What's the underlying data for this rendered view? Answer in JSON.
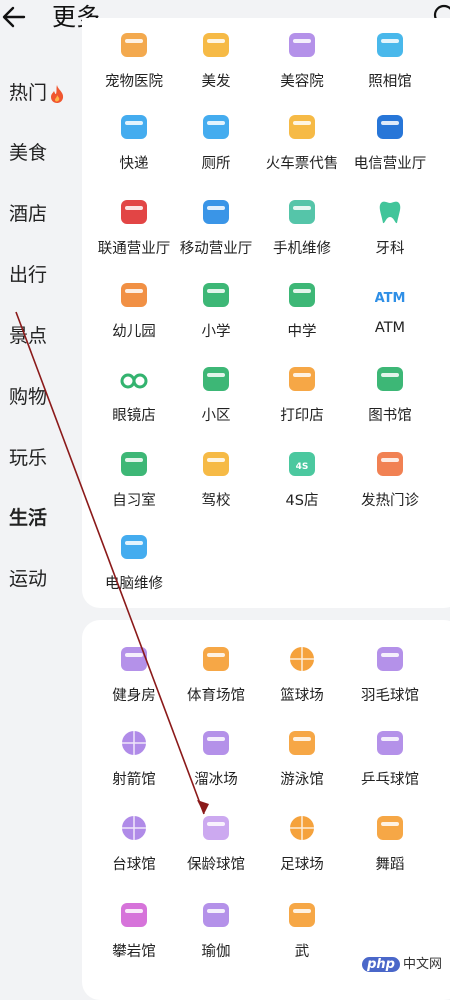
{
  "header": {
    "title": "更多"
  },
  "sidebar": {
    "items": [
      "热门",
      "美食",
      "酒店",
      "出行",
      "景点",
      "购物",
      "玩乐",
      "生活",
      "运动"
    ]
  },
  "section1": {
    "items": [
      {
        "label": "宠物医院",
        "icon": "pet-hospital",
        "color": "#f2a445"
      },
      {
        "label": "美发",
        "icon": "hair-salon",
        "color": "#f5b63c"
      },
      {
        "label": "美容院",
        "icon": "beauty-salon",
        "color": "#b08be8"
      },
      {
        "label": "照相馆",
        "icon": "photo-studio",
        "color": "#3fb4ea"
      },
      {
        "label": "快递",
        "icon": "express",
        "color": "#3aa8ee"
      },
      {
        "label": "厕所",
        "icon": "toilet",
        "color": "#3aa8ee"
      },
      {
        "label": "火车票代售",
        "icon": "train-ticket",
        "color": "#f5b63c"
      },
      {
        "label": "电信营业厅",
        "icon": "telecom",
        "color": "#1b6fd6"
      },
      {
        "label": "联通营业厅",
        "icon": "unicom",
        "color": "#e03b3b"
      },
      {
        "label": "移动营业厅",
        "icon": "mobile",
        "color": "#2f8fe6"
      },
      {
        "label": "手机维修",
        "icon": "phone-repair",
        "color": "#4cc2a4"
      },
      {
        "label": "牙科",
        "icon": "dental",
        "color": "#41c59a"
      },
      {
        "label": "幼儿园",
        "icon": "kindergarten",
        "color": "#f08a3a"
      },
      {
        "label": "小学",
        "icon": "primary-school",
        "color": "#33b36f"
      },
      {
        "label": "中学",
        "icon": "middle-school",
        "color": "#33b36f"
      },
      {
        "label": "ATM",
        "icon": "atm",
        "color": "#2f8fe6"
      },
      {
        "label": "眼镜店",
        "icon": "glasses",
        "color": "#33b36f"
      },
      {
        "label": "小区",
        "icon": "community",
        "color": "#33b36f"
      },
      {
        "label": "打印店",
        "icon": "print-shop",
        "color": "#f5a23c"
      },
      {
        "label": "图书馆",
        "icon": "library",
        "color": "#33b36f"
      },
      {
        "label": "自习室",
        "icon": "study-room",
        "color": "#33b36f"
      },
      {
        "label": "驾校",
        "icon": "driving-school",
        "color": "#f5b63c"
      },
      {
        "label": "4S店",
        "icon": "car-dealer",
        "color": "#41c59a"
      },
      {
        "label": "发热门诊",
        "icon": "fever-clinic",
        "color": "#f07a4a"
      },
      {
        "label": "电脑维修",
        "icon": "computer-repair",
        "color": "#3aa8ee"
      }
    ]
  },
  "section2": {
    "items": [
      {
        "label": "健身房",
        "icon": "gym",
        "color": "#b08be8"
      },
      {
        "label": "体育场馆",
        "icon": "stadium",
        "color": "#f5a23c"
      },
      {
        "label": "篮球场",
        "icon": "basketball",
        "color": "#f5a23c"
      },
      {
        "label": "羽毛球馆",
        "icon": "badminton",
        "color": "#b08be8"
      },
      {
        "label": "射箭馆",
        "icon": "archery",
        "color": "#b08be8"
      },
      {
        "label": "溜冰场",
        "icon": "skating",
        "color": "#b08be8"
      },
      {
        "label": "游泳馆",
        "icon": "swimming",
        "color": "#f5a23c"
      },
      {
        "label": "乒乓球馆",
        "icon": "table-tennis",
        "color": "#b08be8"
      },
      {
        "label": "台球馆",
        "icon": "billiards",
        "color": "#b08be8"
      },
      {
        "label": "保龄球馆",
        "icon": "bowling",
        "color": "#c9a4ef"
      },
      {
        "label": "足球场",
        "icon": "football",
        "color": "#f5a23c"
      },
      {
        "label": "舞蹈",
        "icon": "dance",
        "color": "#f5a23c"
      },
      {
        "label": "攀岩馆",
        "icon": "climbing",
        "color": "#d46bd8"
      },
      {
        "label": "瑜伽",
        "icon": "yoga",
        "color": "#b08be8"
      },
      {
        "label": "武",
        "icon": "martial-arts",
        "color": "#f5a23c"
      }
    ]
  },
  "watermark": {
    "badge": "php",
    "text": "中文网"
  }
}
